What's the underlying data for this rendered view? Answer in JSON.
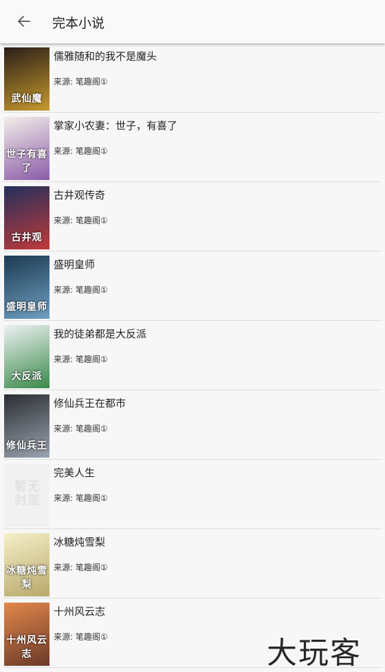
{
  "appbar": {
    "title": "完本小说",
    "back_icon": "arrow-left-icon"
  },
  "books": [
    {
      "title": "儒雅随和的我不是魔头",
      "source": "来源: 笔趣阁①",
      "cover_text": "武仙魔",
      "cover_bg": "#2a1e18",
      "cover_accent": "#c79a2e"
    },
    {
      "title": "掌家小农妻：世子，有喜了",
      "source": "来源: 笔趣阁①",
      "cover_text": "世子有喜了",
      "cover_bg": "#f3eee9",
      "cover_accent": "#8a5ba8"
    },
    {
      "title": "古井观传奇",
      "source": "来源: 笔趣阁①",
      "cover_text": "古井观",
      "cover_bg": "#22305c",
      "cover_accent": "#c13a3a"
    },
    {
      "title": "盛明皇师",
      "source": "来源: 笔趣阁①",
      "cover_text": "盛明皇师",
      "cover_bg": "#1d3a52",
      "cover_accent": "#6fa0c0"
    },
    {
      "title": "我的徒弟都是大反派",
      "source": "来源: 笔趣阁①",
      "cover_text": "大反派",
      "cover_bg": "#eef1f3",
      "cover_accent": "#3a8a4a"
    },
    {
      "title": "修仙兵王在都市",
      "source": "来源: 笔趣阁①",
      "cover_text": "修仙兵王",
      "cover_bg": "#2b2e33",
      "cover_accent": "#9aa4ae"
    },
    {
      "title": "完美人生",
      "source": "来源: 笔趣阁①",
      "cover_text": "暂无封面",
      "cover_bg": "#f1f1f1",
      "cover_accent": "#e2e2e2"
    },
    {
      "title": "冰糖炖雪梨",
      "source": "来源: 笔趣阁①",
      "cover_text": "冰糖炖雪梨",
      "cover_bg": "#f5efc9",
      "cover_accent": "#b8a86a"
    },
    {
      "title": "十州风云志",
      "source": "来源: 笔趣阁①",
      "cover_text": "十州风云志",
      "cover_bg": "#e2874a",
      "cover_accent": "#6b3a2a"
    }
  ],
  "watermark": "大玩客"
}
